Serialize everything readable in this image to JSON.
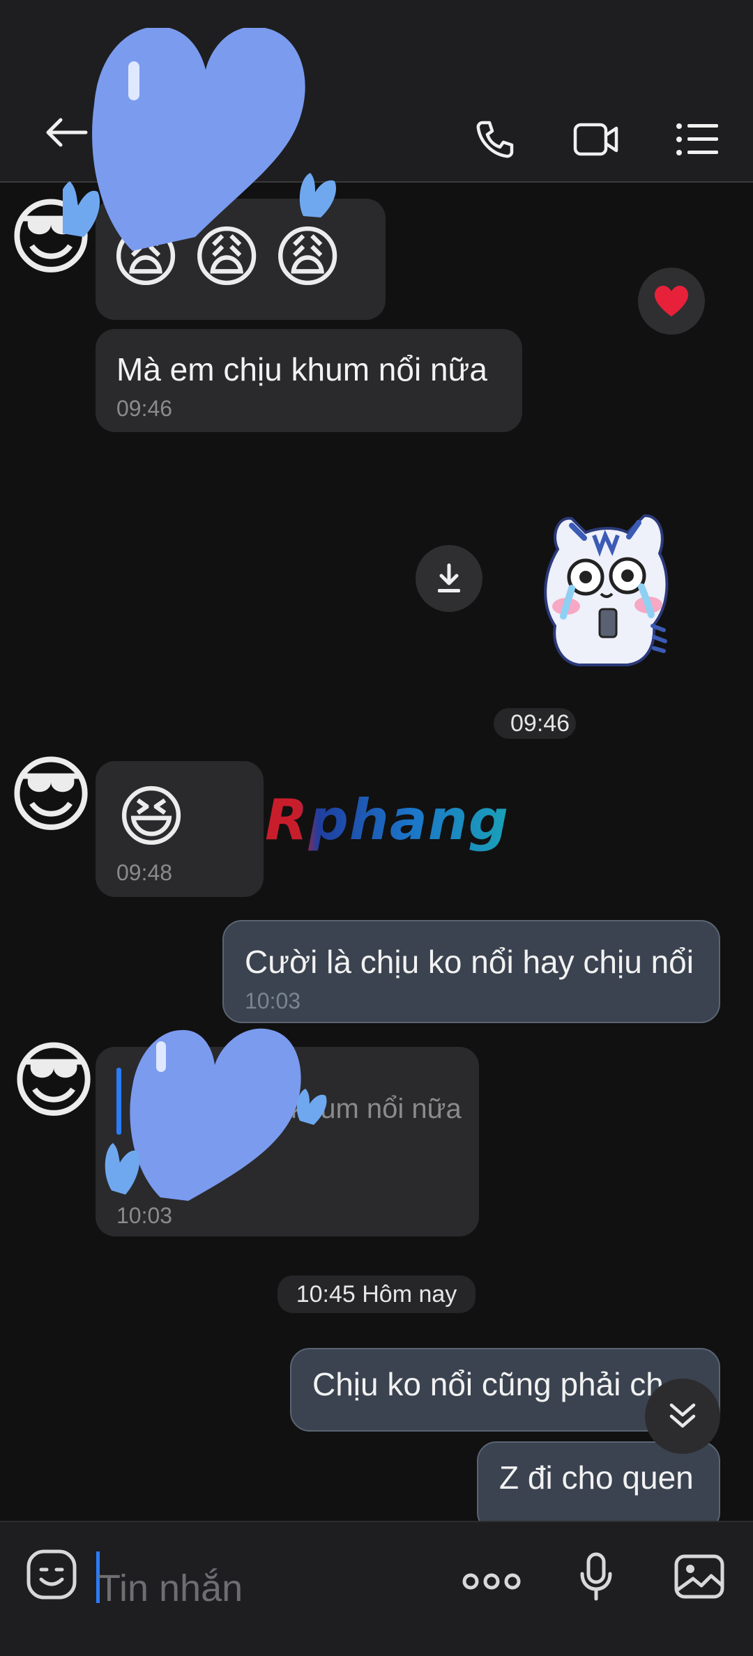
{
  "header": {
    "back_label": "",
    "icons": [
      "arrow-left-icon",
      "phone-icon",
      "video-icon",
      "list-menu-icon"
    ]
  },
  "messages": {
    "m1": {
      "emojis": [
        "😩",
        "😩",
        "😩"
      ]
    },
    "m2": {
      "text": "Mà em chịu khum nổi nữa",
      "time": "09:46"
    },
    "m3": {
      "time": "09:46"
    },
    "m4": {
      "emoji": "😆",
      "time": "09:48"
    },
    "m5": {
      "text": "Cười là chịu ko nổi hay chịu nổi",
      "time": "10:03"
    },
    "m6": {
      "reply_text": "khum nổi nữa",
      "time": "10:03"
    },
    "m7": {
      "text": "Chịu ko nổi cũng phải ch",
      "time": ""
    },
    "m8": {
      "text": "Z đi cho quen"
    }
  },
  "divider": {
    "time_today": "10:45 Hôm nay"
  },
  "watermark": {
    "text": "Rphang"
  },
  "input": {
    "placeholder": "Tin nhắn"
  },
  "colors": {
    "accent": "#2b7cf6",
    "heart": "#7b9bef",
    "reaction": "#e8213a"
  }
}
